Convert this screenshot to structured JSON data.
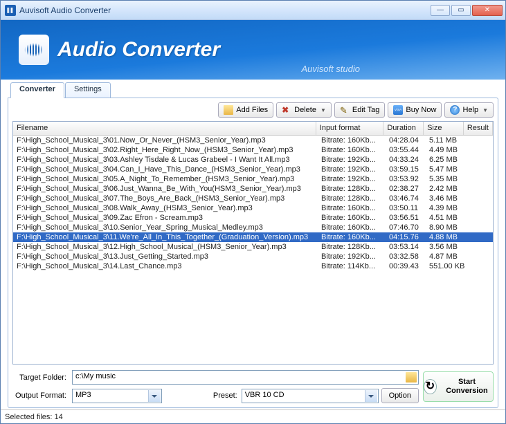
{
  "window": {
    "title": "Auvisoft Audio Converter"
  },
  "banner": {
    "title": "Audio Converter",
    "subtitle": "Auvisoft studio"
  },
  "tabs": [
    {
      "label": "Converter",
      "active": true
    },
    {
      "label": "Settings",
      "active": false
    }
  ],
  "toolbar": {
    "add_files": "Add Files",
    "delete": "Delete",
    "edit_tag": "Edit Tag",
    "buy_now": "Buy Now",
    "help": "Help"
  },
  "columns": {
    "filename": "Filename",
    "input_format": "Input format",
    "duration": "Duration",
    "size": "Size",
    "result": "Result"
  },
  "rows": [
    {
      "filename": "F:\\High_School_Musical_3\\01.Now_Or_Never_(HSM3_Senior_Year).mp3",
      "format": "Bitrate: 160Kb...",
      "duration": "04:28.04",
      "size": "5.11 MB",
      "selected": false
    },
    {
      "filename": "F:\\High_School_Musical_3\\02.Right_Here_Right_Now_(HSM3_Senior_Year).mp3",
      "format": "Bitrate: 160Kb...",
      "duration": "03:55.44",
      "size": "4.49 MB",
      "selected": false
    },
    {
      "filename": "F:\\High_School_Musical_3\\03.Ashley Tisdale & Lucas Grabeel - I Want It All.mp3",
      "format": "Bitrate: 192Kb...",
      "duration": "04:33.24",
      "size": "6.25 MB",
      "selected": false
    },
    {
      "filename": "F:\\High_School_Musical_3\\04.Can_I_Have_This_Dance_(HSM3_Senior_Year).mp3",
      "format": "Bitrate: 192Kb...",
      "duration": "03:59.15",
      "size": "5.47 MB",
      "selected": false
    },
    {
      "filename": "F:\\High_School_Musical_3\\05.A_Night_To_Remember_(HSM3_Senior_Year).mp3",
      "format": "Bitrate: 192Kb...",
      "duration": "03:53.92",
      "size": "5.35 MB",
      "selected": false
    },
    {
      "filename": "F:\\High_School_Musical_3\\06.Just_Wanna_Be_With_You(HSM3_Senior_Year).mp3",
      "format": "Bitrate: 128Kb...",
      "duration": "02:38.27",
      "size": "2.42 MB",
      "selected": false
    },
    {
      "filename": "F:\\High_School_Musical_3\\07.The_Boys_Are_Back_(HSM3_Senior_Year).mp3",
      "format": "Bitrate: 128Kb...",
      "duration": "03:46.74",
      "size": "3.46 MB",
      "selected": false
    },
    {
      "filename": "F:\\High_School_Musical_3\\08.Walk_Away_(HSM3_Senior_Year).mp3",
      "format": "Bitrate: 160Kb...",
      "duration": "03:50.11",
      "size": "4.39 MB",
      "selected": false
    },
    {
      "filename": "F:\\High_School_Musical_3\\09.Zac Efron - Scream.mp3",
      "format": "Bitrate: 160Kb...",
      "duration": "03:56.51",
      "size": "4.51 MB",
      "selected": false
    },
    {
      "filename": "F:\\High_School_Musical_3\\10.Senior_Year_Spring_Musical_Medley.mp3",
      "format": "Bitrate: 160Kb...",
      "duration": "07:46.70",
      "size": "8.90 MB",
      "selected": false
    },
    {
      "filename": "F:\\High_School_Musical_3\\11.We're_All_In_This_Together_(Graduation_Version).mp3",
      "format": "Bitrate: 160Kb...",
      "duration": "04:15.76",
      "size": "4.88 MB",
      "selected": true
    },
    {
      "filename": "F:\\High_School_Musical_3\\12.High_School_Musical_(HSM3_Senior_Year).mp3",
      "format": "Bitrate: 128Kb...",
      "duration": "03:53.14",
      "size": "3.56 MB",
      "selected": false
    },
    {
      "filename": "F:\\High_School_Musical_3\\13.Just_Getting_Started.mp3",
      "format": "Bitrate: 192Kb...",
      "duration": "03:32.58",
      "size": "4.87 MB",
      "selected": false
    },
    {
      "filename": "F:\\High_School_Musical_3\\14.Last_Chance.mp3",
      "format": "Bitrate: 114Kb...",
      "duration": "00:39.43",
      "size": "551.00 KB",
      "selected": false
    }
  ],
  "bottom": {
    "target_folder_label": "Target Folder:",
    "target_folder_value": "c:\\My music",
    "output_format_label": "Output Format:",
    "output_format_value": "MP3",
    "preset_label": "Preset:",
    "preset_value": "VBR 10 CD",
    "option_label": "Option",
    "start_label": "Start Conversion"
  },
  "status": {
    "text": "Selected files: 14"
  }
}
